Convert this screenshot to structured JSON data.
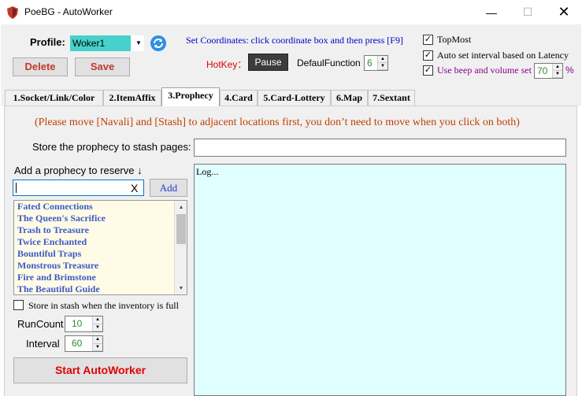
{
  "window": {
    "title": "PoeBG - AutoWorker",
    "min_glyph": "—",
    "max_glyph": "☐",
    "close_glyph": "✕"
  },
  "profile": {
    "label": "Profile:",
    "value": "Woker1",
    "arrow": "▼"
  },
  "buttons": {
    "delete": "Delete",
    "save": "Save",
    "pause": "Pause",
    "add": "Add",
    "start": "Start AutoWorker"
  },
  "coords_hint": "Set Coordinates: click coordinate box and then press [F9]",
  "hotkey_label": "HotKey：",
  "default_function": {
    "label": "DefaulFunction",
    "value": "6"
  },
  "options": {
    "topmost_label": "TopMost",
    "topmost_checked": "✓",
    "auto_interval_label": "Auto set interval based on Latency",
    "auto_interval_checked": "✓",
    "beep_label": "Use beep and volume set",
    "beep_checked": "✓",
    "volume": "70",
    "percent": "%"
  },
  "tabs": [
    {
      "label": "1.Socket/Link/Color"
    },
    {
      "label": "2.ItemAffix"
    },
    {
      "label": "3.Prophecy"
    },
    {
      "label": "4.Card"
    },
    {
      "label": "5.Card-Lottery"
    },
    {
      "label": "6.Map"
    },
    {
      "label": "7.Sextant"
    }
  ],
  "active_tab": "3.Prophecy",
  "prophecy_tab": {
    "move_hint": "(Please move [Navali] and [Stash] to adjacent locations first, you don’t need to move when you click on both)",
    "stash_label": "Store the prophecy to stash pages:",
    "reserve_label": "Add a prophecy to reserve ↓",
    "clear_glyph": "X",
    "list_items": [
      "Fated Connections",
      "The Queen's Sacrifice",
      "Trash to Treasure",
      "Twice Enchanted",
      "Bountiful Traps",
      "Monstrous Treasure",
      "Fire and Brimstone",
      "The Beautiful Guide"
    ],
    "full_label": "Store in stash when the inventory is full",
    "runcount_label": "RunCount",
    "runcount_value": "10",
    "interval_label": "Interval",
    "interval_value": "60",
    "log_text": "Log..."
  },
  "colors": {
    "profile_bg": "#48d1cc",
    "log_bg": "#e0ffff",
    "list_bg": "#fffbe6",
    "accent_red": "#e00000",
    "hint_orange": "#c04000",
    "coords_blue": "#0000cc",
    "beep_purple": "#8b008b"
  },
  "icons": {
    "app": "shield-icon",
    "refresh": "refresh-icon"
  }
}
